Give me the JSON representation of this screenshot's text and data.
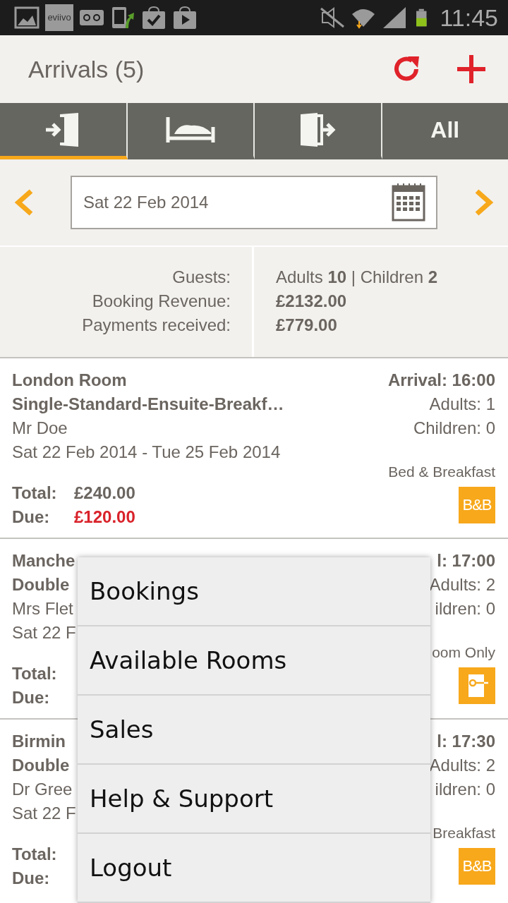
{
  "status_bar": {
    "app_label": "eviivo",
    "time": "11:45"
  },
  "header": {
    "title": "Arrivals (5)"
  },
  "tabs": [
    {
      "kind": "arrivals",
      "selected": true
    },
    {
      "kind": "staying",
      "selected": false
    },
    {
      "kind": "departures",
      "selected": false
    },
    {
      "kind": "text",
      "label": "All",
      "selected": false
    }
  ],
  "date_field": {
    "value": "Sat 22 Feb 2014"
  },
  "summary": {
    "guests": {
      "label": "Guests:",
      "value": "Adults **10** | Children **2**"
    },
    "revenue": {
      "label": "Booking Revenue:",
      "value": "£2132.00"
    },
    "payments": {
      "label": "Payments received:",
      "value": "£779.00"
    }
  },
  "bookings": [
    {
      "title": "London Room",
      "room": "Single-Standard-Ensuite-Breakf…",
      "guest": "Mr Doe",
      "dates": "Sat 22 Feb 2014 - Tue 25 Feb 2014",
      "arrival": "Arrival: 16:00",
      "adults": "Adults: 1",
      "children": "Children: 0",
      "board": "Bed & Breakfast",
      "badge": {
        "kind": "bnb",
        "label": "B&B"
      },
      "total_label": "Total:",
      "total": "£240.00",
      "due_label": "Due:",
      "due": "£120.00"
    },
    {
      "title": "Manche",
      "room": "Double",
      "guest": "Mrs Flet",
      "dates": "Sat 22 F",
      "arrival": "l: 17:00",
      "adults": "Adults: 2",
      "children": "ildren: 0",
      "board": "oom Only",
      "badge": {
        "kind": "room_only"
      },
      "total_label": "Total:",
      "due_label": "Due:"
    },
    {
      "title": "Birmin",
      "room": "Double",
      "guest": "Dr Gree",
      "dates": "Sat 22 F",
      "arrival": "l: 17:30",
      "adults": "Adults: 2",
      "children": "ildren: 0",
      "board": "Breakfast",
      "badge": {
        "kind": "bnb",
        "label": "B&B"
      },
      "total_label": "Total:",
      "due_label": "Due:"
    }
  ],
  "menu": {
    "items": [
      "Bookings",
      "Available Rooms",
      "Sales",
      "Help & Support",
      "Logout"
    ]
  }
}
